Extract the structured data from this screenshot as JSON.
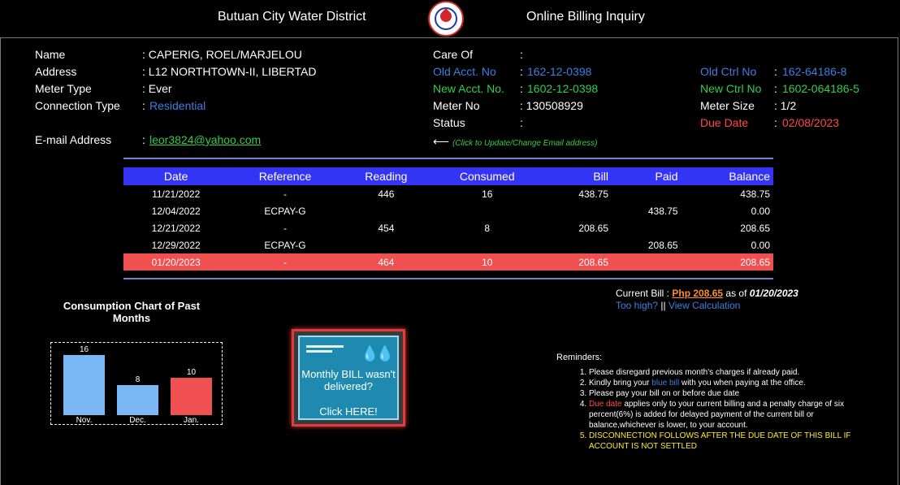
{
  "header": {
    "org_name": "Butuan City Water District",
    "page_name": "Online Billing Inquiry"
  },
  "account": {
    "name_label": "Name",
    "name_value": ": CAPERIG, ROEL/MARJELOU",
    "address_label": "Address",
    "address_value": ": L12 NORTHTOWN-II, LIBERTAD",
    "meter_type_label": "Meter Type",
    "meter_type_value": ": Ever",
    "connection_type_label": "Connection Type",
    "connection_type_colon": ":",
    "connection_type_value": "Residential",
    "email_label": "E-mail Address",
    "email_colon": ":",
    "email_value": "leor3824@yahoo.com",
    "care_of_label": "Care Of",
    "care_of_value": ":",
    "old_acct_label": "Old Acct. No",
    "old_acct_colon": ":",
    "old_acct_value": "162-12-0398",
    "new_acct_label": "New Acct. No.",
    "new_acct_colon": ":",
    "new_acct_value": "1602-12-0398",
    "meter_no_label": "Meter No",
    "meter_no_value": ": 130508929",
    "status_label": "Status",
    "status_value": ":",
    "old_ctrl_label": "Old Ctrl No",
    "old_ctrl_colon": ":",
    "old_ctrl_value": "162-64186-8",
    "new_ctrl_label": "New Ctrl No",
    "new_ctrl_colon": ":",
    "new_ctrl_value": "1602-064186-5",
    "meter_size_label": "Meter Size",
    "meter_size_value": ": 1/2",
    "due_date_label": "Due Date",
    "due_date_colon": ":",
    "due_date_value": "02/08/2023",
    "email_hint": "(Click to Update/Change Email address)"
  },
  "table": {
    "headers": [
      "Date",
      "Reference",
      "Reading",
      "Consumed",
      "Bill",
      "Paid",
      "Balance"
    ],
    "rows": [
      [
        "11/21/2022",
        "-",
        "446",
        "16",
        "438.75",
        "",
        "438.75"
      ],
      [
        "12/04/2022",
        "ECPAY-G",
        "",
        "",
        "",
        "438.75",
        "0.00"
      ],
      [
        "12/21/2022",
        "-",
        "454",
        "8",
        "208.65",
        "",
        "208.65"
      ],
      [
        "12/29/2022",
        "ECPAY-G",
        "",
        "",
        "",
        "208.65",
        "0.00"
      ],
      [
        "01/20/2023",
        "-",
        "464",
        "10",
        "208.65",
        "",
        "208.65"
      ]
    ]
  },
  "current_bill": {
    "label": "Current Bill :",
    "amount": "Php 208.65",
    "as_of": "as of",
    "date": "01/20/2023",
    "too_high": "Too high?",
    "divider": "||",
    "view_calc": "View Calculation"
  },
  "chart_data": {
    "type": "bar",
    "title": "Consumption Chart of Past Months",
    "categories": [
      "Nov.",
      "Dec.",
      "Jan."
    ],
    "values": [
      16,
      8,
      10
    ],
    "colors": [
      "#7ab8f5",
      "#7ab8f5",
      "#f05050"
    ],
    "ylim": [
      0,
      16
    ]
  },
  "promo": {
    "text": "Monthly BILL wasn't delivered?",
    "cta": "Click HERE!"
  },
  "reminders": {
    "title": "Reminders:",
    "r1": "Please disregard previous month's charges if already paid.",
    "r2_a": "Kindly bring your",
    "r2_b": "blue bill",
    "r2_c": "with you when paying at the office.",
    "r3": "Please pay your bill on or before due date",
    "r4_a": "Due date",
    "r4_b": "applies only to your current billing and a penalty charge of six percent(6%) is added for delayed payment of the current bill or balance,whichever is lower, to your account.",
    "r5": "DISCONNECTION FOLLOWS AFTER THE DUE DATE OF THIS BILL IF ACCOUNT IS NOT SETTLED"
  },
  "colors": {
    "header_row": "#3434f4",
    "current_row": "#f05050",
    "accent_blue": "#3d7fe0",
    "accent_green": "#2fcf4a",
    "accent_red": "#ff4a43"
  }
}
